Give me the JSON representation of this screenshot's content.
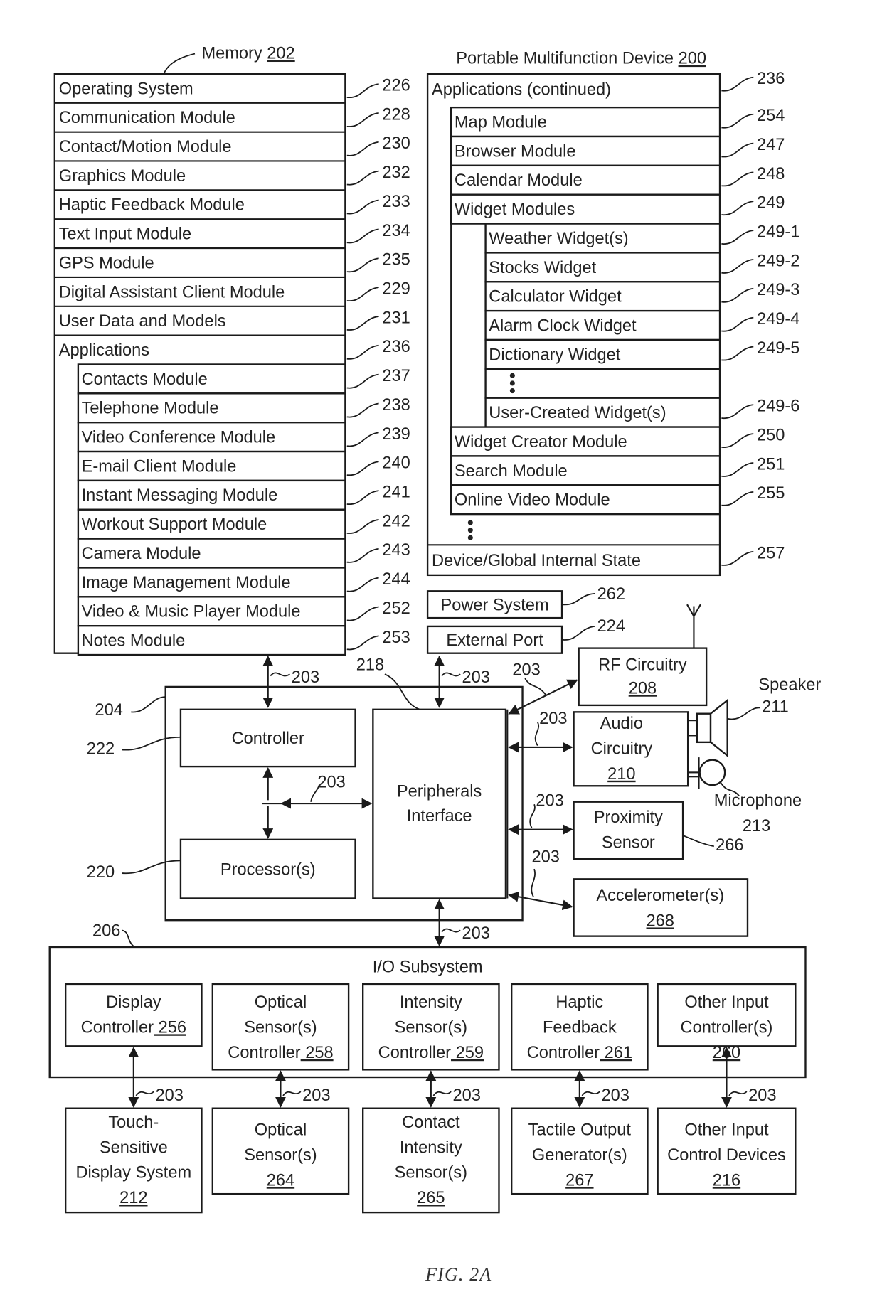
{
  "memory": {
    "title": "Memory",
    "ref": "202",
    "rows": [
      {
        "label": "Operating System",
        "ref": "226"
      },
      {
        "label": "Communication Module",
        "ref": "228"
      },
      {
        "label": "Contact/Motion Module",
        "ref": "230"
      },
      {
        "label": "Graphics Module",
        "ref": "232"
      },
      {
        "label": "Haptic Feedback Module",
        "ref": "233"
      },
      {
        "label": "Text Input Module",
        "ref": "234"
      },
      {
        "label": "GPS Module",
        "ref": "235"
      },
      {
        "label": "Digital Assistant Client Module",
        "ref": "229"
      },
      {
        "label": "User Data and Models",
        "ref": "231"
      },
      {
        "label": "Applications",
        "ref": "236"
      }
    ],
    "apps": [
      {
        "label": "Contacts Module",
        "ref": "237"
      },
      {
        "label": "Telephone Module",
        "ref": "238"
      },
      {
        "label": "Video Conference Module",
        "ref": "239"
      },
      {
        "label": "E-mail Client Module",
        "ref": "240"
      },
      {
        "label": "Instant Messaging Module",
        "ref": "241"
      },
      {
        "label": "Workout Support Module",
        "ref": "242"
      },
      {
        "label": "Camera Module",
        "ref": "243"
      },
      {
        "label": "Image Management Module",
        "ref": "244"
      },
      {
        "label": "Video & Music Player Module",
        "ref": "252"
      },
      {
        "label": "Notes Module",
        "ref": "253"
      }
    ]
  },
  "device": {
    "title": "Portable Multifunction Device",
    "ref": "200",
    "apps_header": {
      "label": "Applications (continued)",
      "ref": "236"
    },
    "apps": [
      {
        "label": "Map Module",
        "ref": "254"
      },
      {
        "label": "Browser Module",
        "ref": "247"
      },
      {
        "label": "Calendar Module",
        "ref": "248"
      },
      {
        "label": "Widget Modules",
        "ref": "249"
      }
    ],
    "widgets": [
      {
        "label": "Weather Widget(s)",
        "ref": "249-1"
      },
      {
        "label": "Stocks Widget",
        "ref": "249-2"
      },
      {
        "label": "Calculator Widget",
        "ref": "249-3"
      },
      {
        "label": "Alarm Clock Widget",
        "ref": "249-4"
      },
      {
        "label": "Dictionary Widget",
        "ref": "249-5"
      },
      {
        "label": "",
        "ref": ""
      },
      {
        "label": "User-Created Widget(s)",
        "ref": "249-6"
      }
    ],
    "apps_after": [
      {
        "label": "Widget Creator Module",
        "ref": "250"
      },
      {
        "label": "Search Module",
        "ref": "251"
      },
      {
        "label": "Online Video Module",
        "ref": "255"
      }
    ],
    "state": {
      "label": "Device/Global Internal State",
      "ref": "257"
    }
  },
  "power": {
    "label": "Power System",
    "ref": "262"
  },
  "port": {
    "label": "External Port",
    "ref": "224"
  },
  "rf": {
    "label": "RF Circuitry",
    "ref": "208"
  },
  "audio": {
    "line1": "Audio",
    "line2": "Circuitry",
    "ref": "210"
  },
  "speaker": {
    "label": "Speaker",
    "ref": "211"
  },
  "microphone": {
    "label": "Microphone",
    "ref": "213"
  },
  "proximity": {
    "line1": "Proximity",
    "line2": "Sensor",
    "ref": "266"
  },
  "accelerometer": {
    "label": "Accelerometer(s)",
    "ref": "268"
  },
  "chip": {
    "ref": "204",
    "controller": {
      "label": "Controller",
      "ref": "222"
    },
    "processor": {
      "label": "Processor(s)",
      "ref": "220"
    },
    "peripherals": {
      "line1": "Peripherals",
      "line2": "Interface",
      "ref": "218"
    }
  },
  "bus_ref": "203",
  "io": {
    "title": "I/O Subsystem",
    "ref": "206",
    "controllers": [
      {
        "lines": [
          "Display",
          "Controller"
        ],
        "ref": "256"
      },
      {
        "lines": [
          "Optical",
          "Sensor(s)",
          "Controller"
        ],
        "ref": "258"
      },
      {
        "lines": [
          "Intensity",
          "Sensor(s)",
          "Controller"
        ],
        "ref": "259"
      },
      {
        "lines": [
          "Haptic",
          "Feedback",
          "Controller"
        ],
        "ref": "261"
      },
      {
        "lines": [
          "Other Input",
          "Controller(s)"
        ],
        "ref": "260"
      }
    ],
    "devices": [
      {
        "lines": [
          "Touch-",
          "Sensitive",
          "Display System"
        ],
        "ref": "212"
      },
      {
        "lines": [
          "Optical",
          "Sensor(s)"
        ],
        "ref": "264"
      },
      {
        "lines": [
          "Contact",
          "Intensity",
          "Sensor(s)"
        ],
        "ref": "265"
      },
      {
        "lines": [
          "Tactile Output",
          "Generator(s)"
        ],
        "ref": "267"
      },
      {
        "lines": [
          "Other Input",
          "Control Devices"
        ],
        "ref": "216"
      }
    ]
  },
  "figure_caption": "FIG. 2A"
}
